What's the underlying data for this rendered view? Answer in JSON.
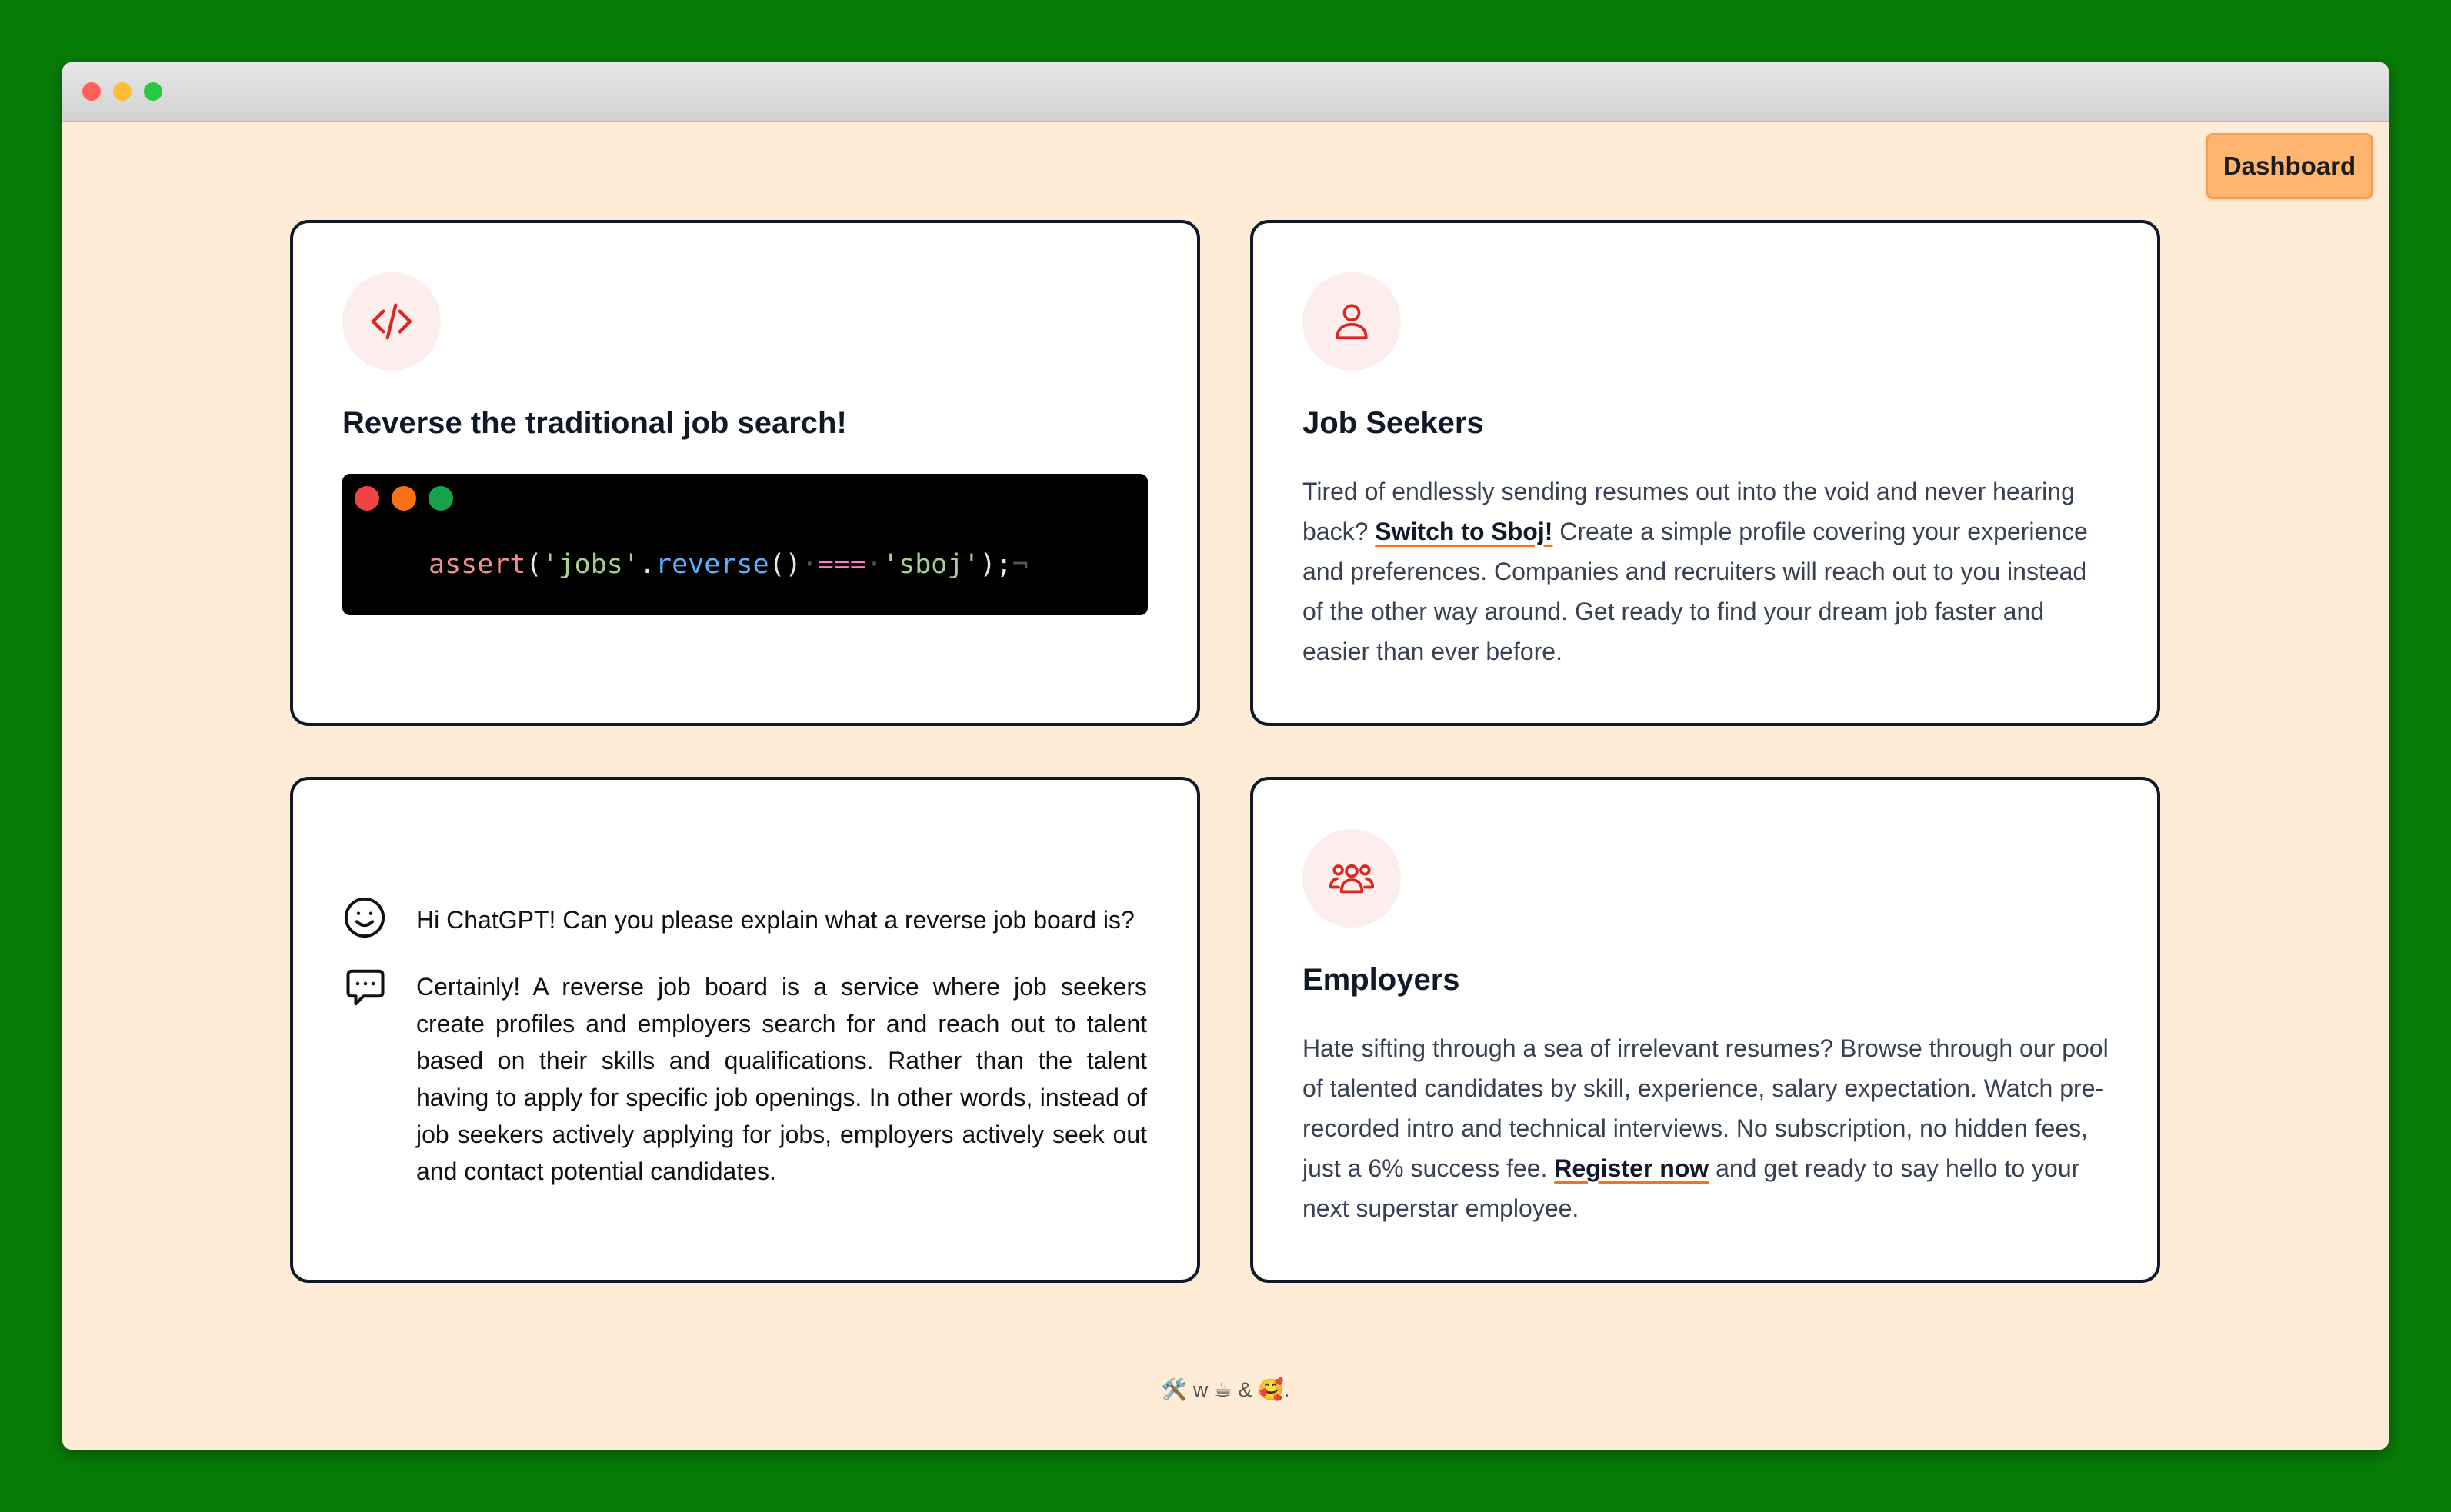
{
  "header": {
    "dashboard_label": "Dashboard"
  },
  "cards": {
    "intro": {
      "icon": "code-icon",
      "title": "Reverse the traditional job search!",
      "code": {
        "fn": "assert",
        "open": "(",
        "str1": "'jobs'",
        "dot": ".",
        "method": "reverse",
        "call": "()",
        "ws1": "·",
        "op": "===",
        "ws2": "·",
        "str2": "'sboj'",
        "close": ");",
        "eol": "¬"
      }
    },
    "seekers": {
      "icon": "user-icon",
      "title": "Job Seekers",
      "text_before": "Tired of endlessly sending resumes out into the void and never hearing back? ",
      "link": "Switch to Sboj!",
      "text_after": " Create a simple profile covering your experience and preferences. Companies and recruiters will reach out to you instead of the other way around. Get ready to find your dream job faster and easier than ever before."
    },
    "chat": {
      "question": "Hi ChatGPT! Can you please explain what a reverse job board is?",
      "answer": "Certainly! A reverse job board is a service where job seekers create profiles and employers search for and reach out to talent based on their skills and qualifications. Rather than the talent having to apply for specific job openings. In other words, instead of job seekers actively applying for jobs, employers actively seek out and contact potential candidates."
    },
    "employers": {
      "icon": "users-group-icon",
      "title": "Employers",
      "text_before": "Hate sifting through a sea of irrelevant resumes? Browse through our pool of talented candidates by skill, experience, salary expectation. Watch pre-recorded intro and technical interviews. No subscription, no hidden fees, just a 6% success fee. ",
      "link": "Register now",
      "text_after": " and get ready to say hello to your next superstar employee."
    }
  },
  "footer": {
    "text": "🛠️ w ☕ & 🥰."
  },
  "colors": {
    "page_bg": "#ffecd6",
    "accent": "#dc2626",
    "button": "#ffb570",
    "outer_bg": "#077d07"
  }
}
